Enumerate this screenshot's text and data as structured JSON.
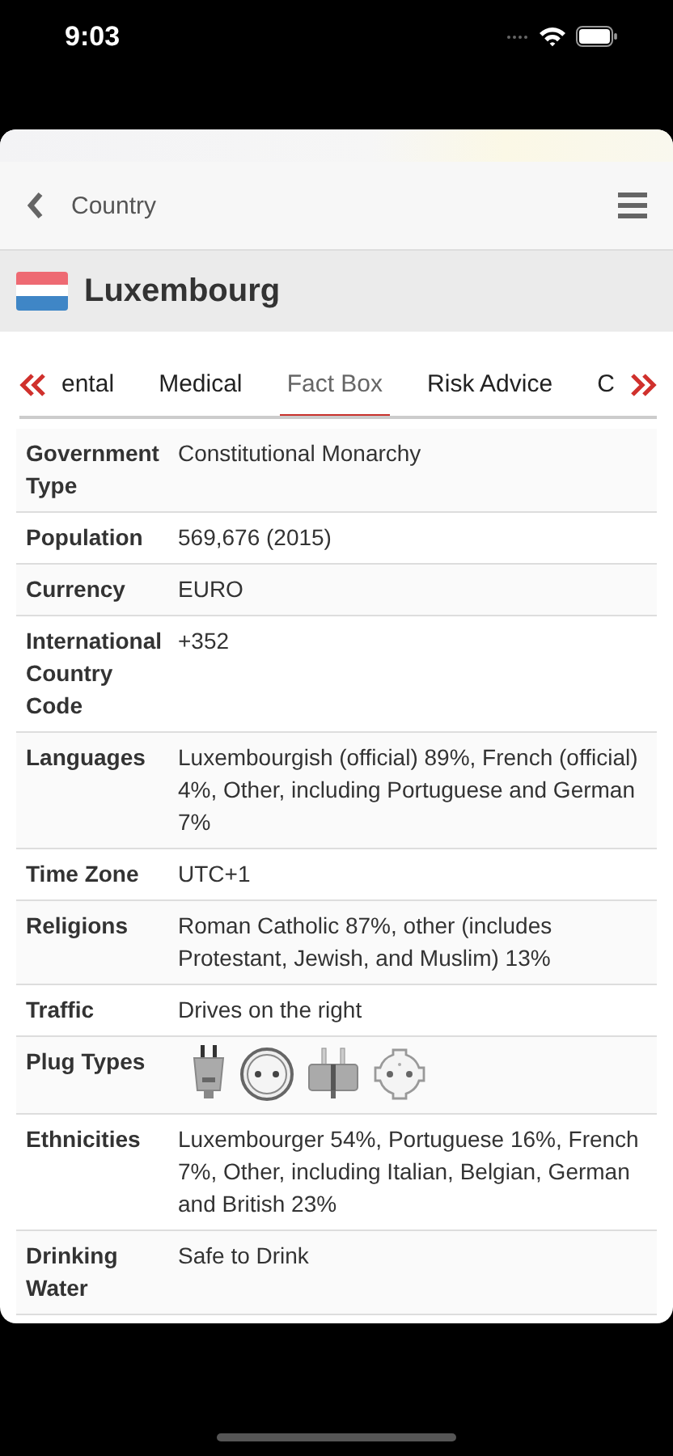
{
  "status_bar": {
    "time": "9:03"
  },
  "nav": {
    "back_label": "Country"
  },
  "header": {
    "title": "Luxembourg"
  },
  "tabs": [
    {
      "label": "ental",
      "selected": false
    },
    {
      "label": "Medical",
      "selected": false
    },
    {
      "label": "Fact Box",
      "selected": true
    },
    {
      "label": "Risk Advice",
      "selected": false
    },
    {
      "label": "C",
      "selected": false
    }
  ],
  "table": {
    "rows": [
      {
        "kind": "text",
        "label": "Government Type",
        "value": "Constitutional Monarchy"
      },
      {
        "kind": "text",
        "label": "Population",
        "value": "569,676 (2015)"
      },
      {
        "kind": "text",
        "label": "Currency",
        "value": "EURO"
      },
      {
        "kind": "text",
        "label": "International Country Code",
        "value": "+352"
      },
      {
        "kind": "text",
        "label": "Languages",
        "value": "Luxembourgish (official) 89%, French (official) 4%, Other, including Portuguese and German 7%"
      },
      {
        "kind": "text",
        "label": "Time Zone",
        "value": "UTC+1"
      },
      {
        "kind": "text",
        "label": "Religions",
        "value": "Roman Catholic 87%, other (includes Protestant, Jewish, and Muslim) 13%"
      },
      {
        "kind": "text",
        "label": "Traffic",
        "value": "Drives on the right"
      },
      {
        "kind": "plugs",
        "label": "Plug Types"
      },
      {
        "kind": "text",
        "label": "Ethnicities",
        "value": "Luxembourger 54%, Portuguese 16%, French 7%, Other, including Italian, Belgian, German and British 23%"
      },
      {
        "kind": "text",
        "label": "Drinking Water",
        "value": "Safe to Drink"
      }
    ]
  }
}
